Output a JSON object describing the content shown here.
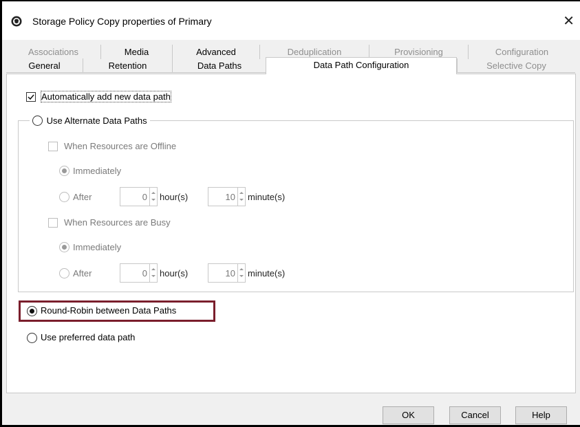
{
  "window": {
    "title": "Storage Policy Copy properties of Primary",
    "close_label": "✕",
    "app_icon": "shield-logo-icon"
  },
  "tabs": {
    "row1": [
      {
        "label": "Associations",
        "enabled": false
      },
      {
        "label": "Media",
        "enabled": true
      },
      {
        "label": "Advanced",
        "enabled": true
      },
      {
        "label": "Deduplication",
        "enabled": false
      },
      {
        "label": "Provisioning",
        "enabled": false
      },
      {
        "label": "Configuration",
        "enabled": false
      }
    ],
    "row2": [
      {
        "label": "General",
        "enabled": true
      },
      {
        "label": "Retention",
        "enabled": true
      },
      {
        "label": "Data Paths",
        "enabled": true
      },
      {
        "label": "Data Path Configuration",
        "enabled": true,
        "selected": true
      },
      {
        "label": "Selective Copy",
        "enabled": false
      }
    ]
  },
  "options": {
    "auto_add": {
      "label": "Automatically add new data path",
      "checked": true
    },
    "use_alternate": {
      "label": "Use Alternate Data Paths",
      "selected": false
    },
    "offline": {
      "label": "When Resources are Offline",
      "checked": false,
      "immediately_label": "Immediately",
      "after_label": "After",
      "hours": "0",
      "hours_unit": "hour(s)",
      "minutes": "10",
      "minutes_unit": "minute(s)"
    },
    "busy": {
      "label": "When Resources are Busy",
      "checked": false,
      "immediately_label": "Immediately",
      "after_label": "After",
      "hours": "0",
      "hours_unit": "hour(s)",
      "minutes": "10",
      "minutes_unit": "minute(s)"
    },
    "round_robin": {
      "label": "Round-Robin between Data Paths",
      "selected": true
    },
    "preferred": {
      "label": "Use preferred data path",
      "selected": false
    }
  },
  "buttons": {
    "ok": "OK",
    "cancel": "Cancel",
    "help": "Help"
  },
  "colors": {
    "highlight": "#7a1e2c",
    "disabled_text": "#7a7a7a"
  }
}
